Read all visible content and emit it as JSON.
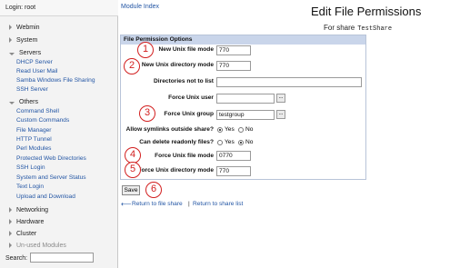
{
  "login": "Login: root",
  "sidebar": {
    "categories": [
      {
        "label": "Webmin",
        "open": false
      },
      {
        "label": "System",
        "open": false
      },
      {
        "label": "Servers",
        "open": true
      },
      {
        "label": "Others",
        "open": true
      },
      {
        "label": "Networking",
        "open": false
      },
      {
        "label": "Hardware",
        "open": false
      },
      {
        "label": "Cluster",
        "open": false
      },
      {
        "label": "Un-used Modules",
        "open": false
      }
    ],
    "servers_modules": [
      "DHCP Server",
      "Read User Mail",
      "Samba Windows File Sharing",
      "SSH Server"
    ],
    "others_modules": [
      "Command Shell",
      "Custom Commands",
      "File Manager",
      "HTTP Tunnel",
      "Perl Modules",
      "Protected Web Directories",
      "SSH Login",
      "System and Server Status",
      "Text Login",
      "Upload and Download"
    ],
    "search_label": "Search:"
  },
  "header": {
    "module_index": "Module Index",
    "title": "Edit File Permissions",
    "subtitle_prefix": "For share",
    "share_name": "TestShare"
  },
  "form": {
    "section_title": "File Permission Options",
    "rows": {
      "unix_file_mode": {
        "label": "New Unix file mode",
        "value": "770"
      },
      "unix_dir_mode": {
        "label": "New Unix directory mode",
        "value": "770"
      },
      "dirs_not_list": {
        "label": "Directories not to list",
        "value": ""
      },
      "force_user": {
        "label": "Force Unix user",
        "value": ""
      },
      "force_group": {
        "label": "Force Unix group",
        "value": "testgroup"
      },
      "symlinks": {
        "label": "Allow symlinks outside share?",
        "yes": "Yes",
        "no": "No",
        "selected": "Yes"
      },
      "delete_readonly": {
        "label": "Can delete readonly files?",
        "yes": "Yes",
        "no": "No",
        "selected": "No"
      },
      "force_file_mode": {
        "label": "Force Unix file mode",
        "value": "0770"
      },
      "force_dir_mode": {
        "label": "Force Unix directory mode",
        "value": "770"
      }
    },
    "chooser_label": "..."
  },
  "actions": {
    "save_label": "Save",
    "return_share": "Return to file share",
    "separator": "|",
    "return_list": "Return to share list"
  },
  "annotations": [
    "1",
    "2",
    "3",
    "4",
    "5",
    "6"
  ],
  "colors": {
    "annotation": "#d21f1f",
    "link": "#2255a4",
    "section_header": "#c9d5ea"
  }
}
